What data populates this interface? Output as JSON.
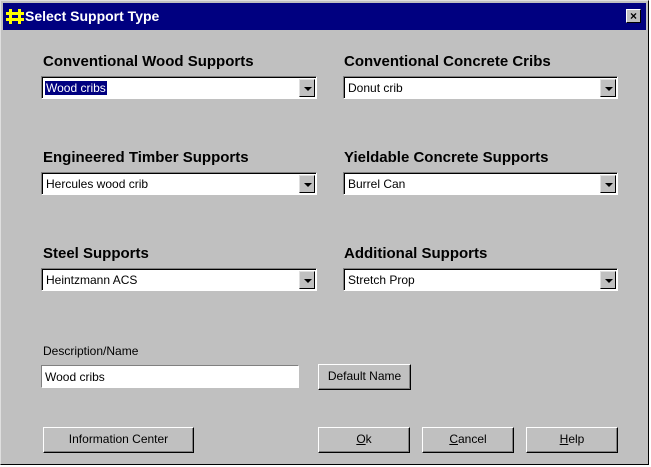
{
  "window": {
    "title": "Select Support Type",
    "close_glyph": "×"
  },
  "groups": {
    "conv_wood": {
      "label": "Conventional Wood Supports",
      "value": "Wood cribs"
    },
    "conv_concrete": {
      "label": "Conventional Concrete Cribs",
      "value": "Donut crib"
    },
    "eng_timber": {
      "label": "Engineered Timber Supports",
      "value": "Hercules wood crib"
    },
    "yield_concrete": {
      "label": "Yieldable Concrete Supports",
      "value": "Burrel Can"
    },
    "steel": {
      "label": "Steel Supports",
      "value": "Heintzmann ACS"
    },
    "additional": {
      "label": "Additional Supports",
      "value": "Stretch Prop"
    }
  },
  "description": {
    "label": "Description/Name",
    "value": "Wood cribs"
  },
  "buttons": {
    "default_name": "Default Name",
    "info_center": "Information Center",
    "ok_accel": "O",
    "ok_rest": "k",
    "cancel_accel": "C",
    "cancel_rest": "ancel",
    "help_accel": "H",
    "help_rest": "elp"
  },
  "colors": {
    "titlebar": "#000080",
    "face": "#c0c0c0",
    "selection": "#000080",
    "icon": "#ffff00"
  }
}
